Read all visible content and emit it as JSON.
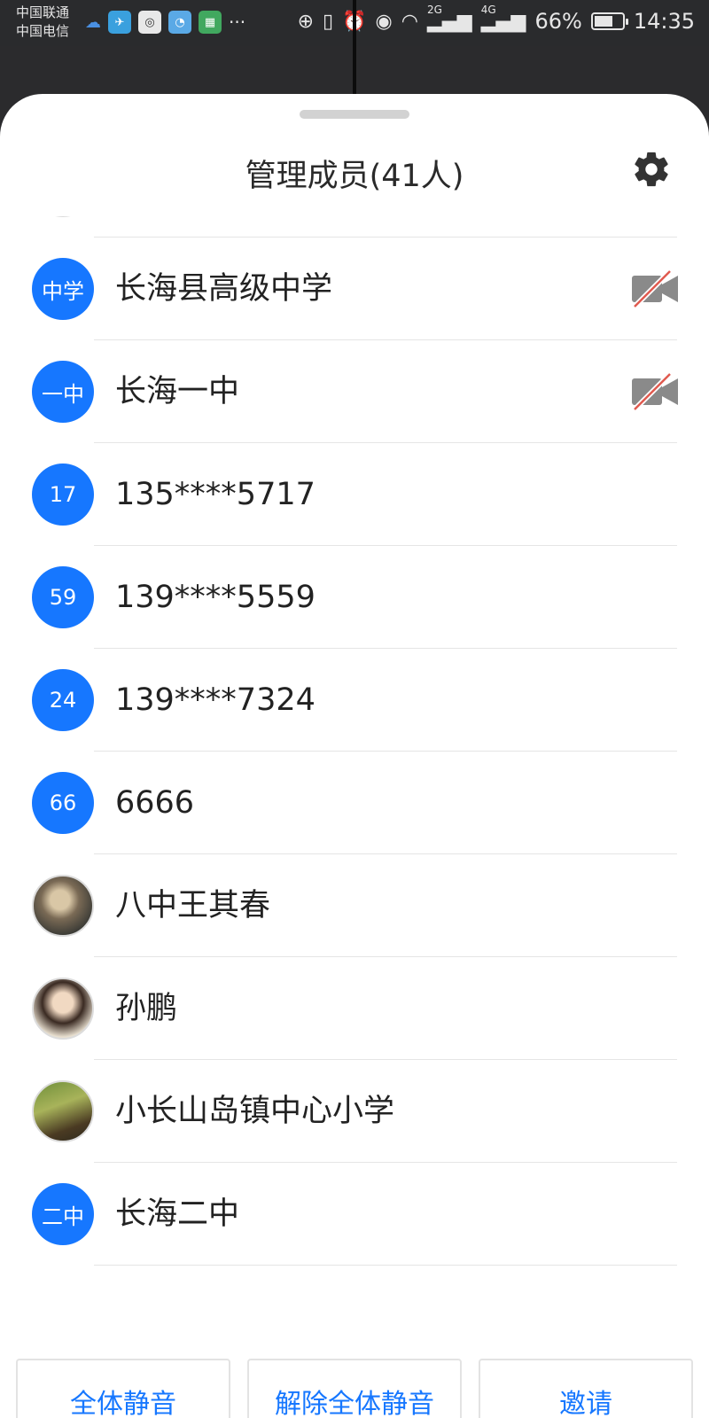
{
  "status_bar": {
    "carrier_1": "中国联通",
    "carrier_2": "中国电信",
    "overflow": "···",
    "battery_text": "66%",
    "battery_level": 0.66,
    "time": "14:35",
    "signal_1_label": "2G",
    "signal_2_label": "4G"
  },
  "sheet": {
    "title": "管理成员(41人)"
  },
  "members": [
    {
      "avatar_text": "中学",
      "name": "长海县高级中学",
      "camera_off": true,
      "avatar_type": "text"
    },
    {
      "avatar_text": "一中",
      "name": "长海一中",
      "camera_off": true,
      "avatar_type": "text"
    },
    {
      "avatar_text": "17",
      "name": "135****5717",
      "camera_off": false,
      "avatar_type": "text"
    },
    {
      "avatar_text": "59",
      "name": "139****5559",
      "camera_off": false,
      "avatar_type": "text"
    },
    {
      "avatar_text": "24",
      "name": "139****7324",
      "camera_off": false,
      "avatar_type": "text"
    },
    {
      "avatar_text": "66",
      "name": "6666",
      "camera_off": false,
      "avatar_type": "text"
    },
    {
      "avatar_text": "",
      "name": "八中王其春",
      "camera_off": false,
      "avatar_type": "photo"
    },
    {
      "avatar_text": "",
      "name": "孙鹏",
      "camera_off": false,
      "avatar_type": "photo"
    },
    {
      "avatar_text": "",
      "name": "小长山岛镇中心小学",
      "camera_off": false,
      "avatar_type": "photo"
    },
    {
      "avatar_text": "二中",
      "name": "长海二中",
      "camera_off": false,
      "avatar_type": "text"
    }
  ],
  "buttons": {
    "mute_all": "全体静音",
    "unmute_all": "解除全体静音",
    "invite": "邀请"
  },
  "colors": {
    "accent": "#1677ff",
    "status_bar": "#2a2b2d",
    "camera_off_slash": "#e05a4f"
  },
  "icons": {
    "settings": "gear-icon",
    "camera_off": "video-off-icon"
  }
}
